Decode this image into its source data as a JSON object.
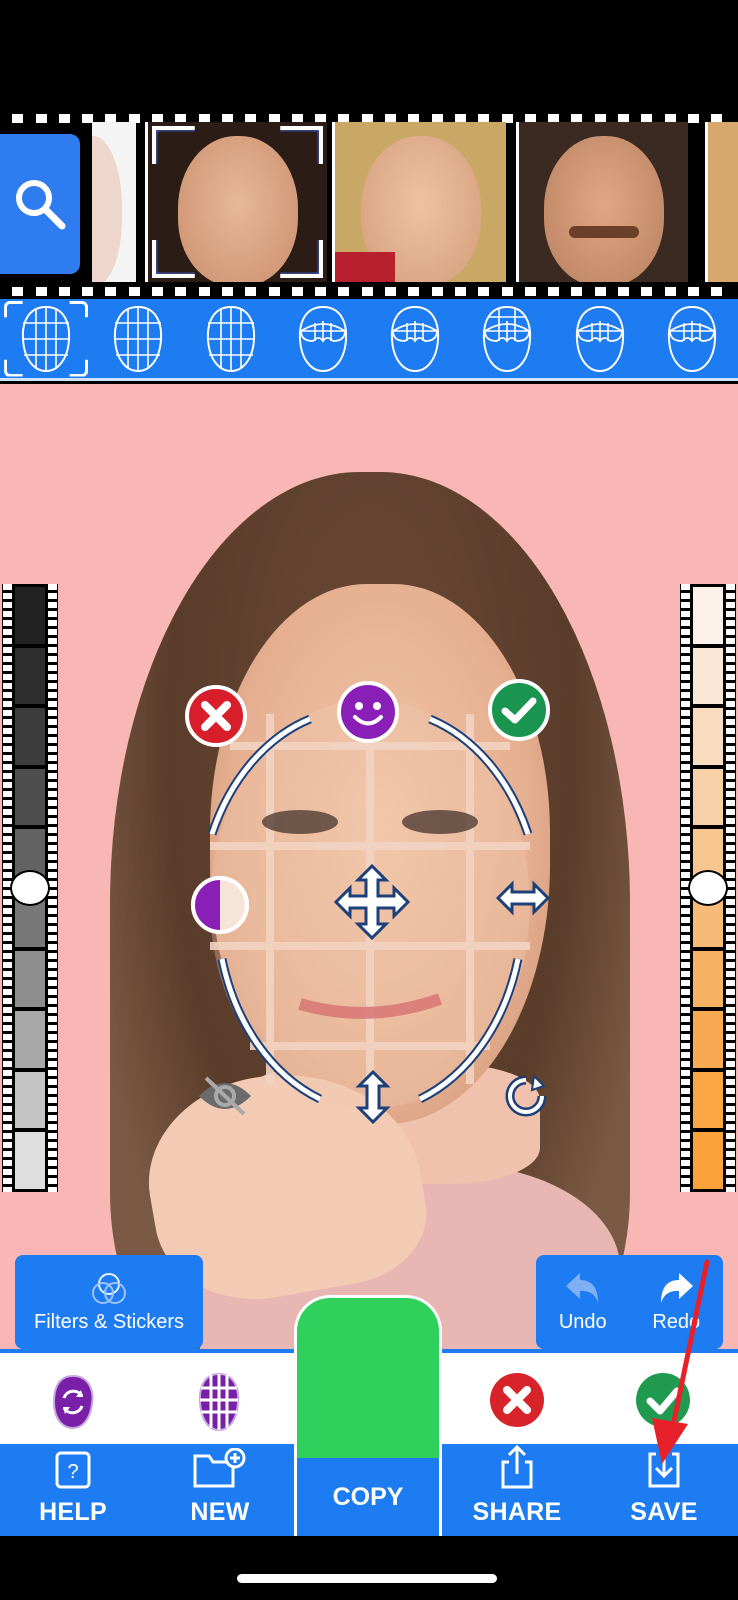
{
  "film_strip": {
    "search_button": {
      "icon": "search-icon"
    },
    "faces": [
      {
        "name": "Partial face",
        "selected": false,
        "skin": "#efd6cc",
        "bg": "#f4f4f4"
      },
      {
        "name": "Face 1",
        "selected": true,
        "skin": "#d9a886",
        "bg": "#2b1c16"
      },
      {
        "name": "Face 2",
        "selected": false,
        "skin": "#e6b494",
        "bg": "#c9a865"
      },
      {
        "name": "Face 3",
        "selected": false,
        "skin": "#d49a78",
        "bg": "#3a2a22"
      },
      {
        "name": "Partial face",
        "selected": false,
        "skin": "#e2b58a",
        "bg": "#d7a86d"
      }
    ]
  },
  "templates": {
    "items": [
      {
        "type": "full-grid",
        "selected": true
      },
      {
        "type": "full-grid",
        "selected": false
      },
      {
        "type": "full-grid",
        "selected": false
      },
      {
        "type": "eyes",
        "selected": false
      },
      {
        "type": "eyes",
        "selected": false
      },
      {
        "type": "eyes-brow",
        "selected": false
      },
      {
        "type": "eyes",
        "selected": false
      },
      {
        "type": "eyes",
        "selected": false
      }
    ]
  },
  "editor": {
    "background_color": "#f8b6b5",
    "overlay_controls": {
      "delete": "close-icon",
      "face": "smiley-icon",
      "confirm": "checkmark-icon",
      "contrast": "half-circle-icon",
      "move": "move-arrows-icon",
      "stretch_horizontal": "horizontal-arrows-icon",
      "stretch_vertical": "vertical-arrows-icon",
      "hide": "eye-off-icon",
      "rotate": "rotate-icon"
    },
    "brightness_slider": {
      "value": 0.5,
      "steps": 10
    },
    "skin_tone_slider": {
      "value": 0.5,
      "steps": 10
    }
  },
  "buttons": {
    "filters": "Filters & Stickers",
    "undo": "Undo",
    "redo": "Redo"
  },
  "action_row": {
    "items": [
      {
        "icon": "swap-face-icon",
        "color": "#7a1fa8"
      },
      {
        "icon": "face-grid-icon",
        "color": "#7a1fa8"
      },
      {
        "icon": "cancel-icon",
        "color": "#d8232a"
      },
      {
        "icon": "confirm-icon",
        "color": "#1f9a4f"
      }
    ]
  },
  "tabs": {
    "help": "HELP",
    "new": "NEW",
    "copy": "COPY",
    "share": "SHARE",
    "save": "SAVE"
  },
  "colors": {
    "primary_blue": "#1d7cf2",
    "copy_green": "#2fd15c",
    "annotation_red": "#e8202a"
  }
}
